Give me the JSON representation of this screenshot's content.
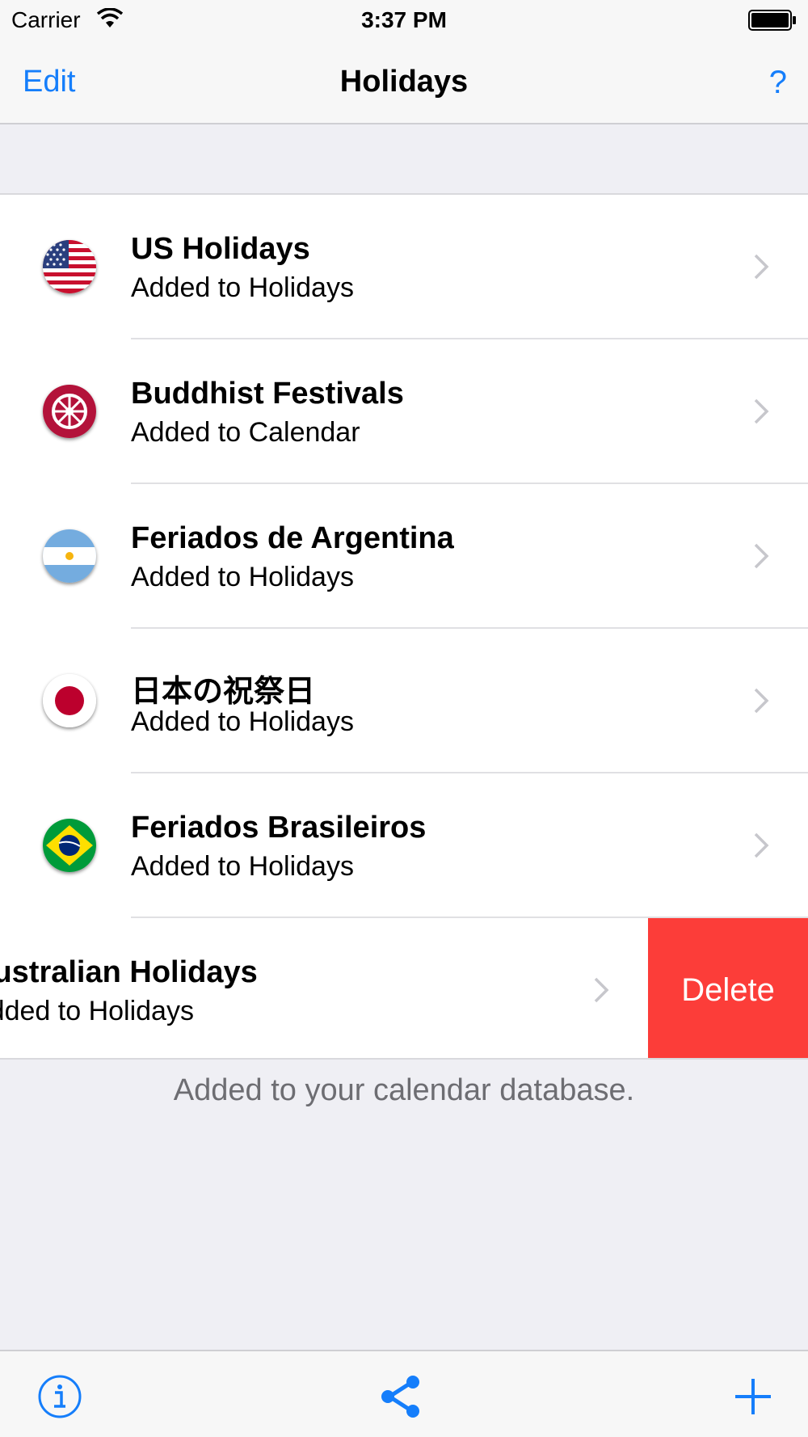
{
  "status_bar": {
    "carrier": "Carrier",
    "time": "3:37 PM"
  },
  "nav": {
    "edit_label": "Edit",
    "title": "Holidays",
    "help_label": "?"
  },
  "rows": [
    {
      "title": "US Holidays",
      "subtitle": "Added to Holidays",
      "icon": "us-flag-icon"
    },
    {
      "title": "Buddhist Festivals",
      "subtitle": "Added to Calendar",
      "icon": "dharma-wheel-icon"
    },
    {
      "title": "Feriados de Argentina",
      "subtitle": "Added to Holidays",
      "icon": "argentina-flag-icon"
    },
    {
      "title": "日本の祝祭日",
      "subtitle": "Added to Holidays",
      "icon": "japan-flag-icon"
    },
    {
      "title": "Feriados Brasileiros",
      "subtitle": "Added to Holidays",
      "icon": "brazil-flag-icon"
    },
    {
      "title": "Australian Holidays",
      "subtitle": "Added to Holidays",
      "icon": "australia-flag-icon"
    }
  ],
  "delete_label": "Delete",
  "footer_text": "Added to your calendar database.",
  "toolbar": {
    "info_icon": "info-icon",
    "share_icon": "share-icon",
    "add_icon": "plus-icon"
  },
  "colors": {
    "accent": "#157efb",
    "delete": "#fc3d39",
    "background": "#efeff4"
  }
}
